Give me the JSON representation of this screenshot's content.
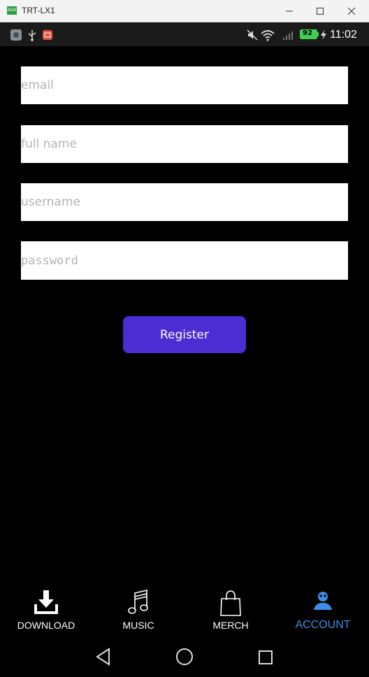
{
  "window": {
    "title": "TRT-LX1",
    "app_icon_text": "ADK"
  },
  "statusbar": {
    "time": "11:02",
    "battery": "92",
    "icons": [
      "app-icon",
      "usb-icon",
      "notification-icon",
      "mute-icon",
      "wifi-icon",
      "signal-icon",
      "battery-icon",
      "charging-icon"
    ]
  },
  "form": {
    "email_placeholder": "email",
    "fullname_placeholder": "full name",
    "username_placeholder": "username",
    "password_placeholder": "password",
    "register_label": "Register",
    "accent_color": "#4a2ed3"
  },
  "tabs": [
    {
      "label": "DOWNLOAD",
      "icon": "download-icon"
    },
    {
      "label": "MUSIC",
      "icon": "music-note-icon"
    },
    {
      "label": "MERCH",
      "icon": "shopping-bag-icon"
    },
    {
      "label": "ACCOUNT",
      "icon": "account-icon",
      "active": true,
      "color": "#3f8ee6"
    }
  ],
  "navbar": [
    "back-icon",
    "home-icon",
    "recents-icon"
  ]
}
